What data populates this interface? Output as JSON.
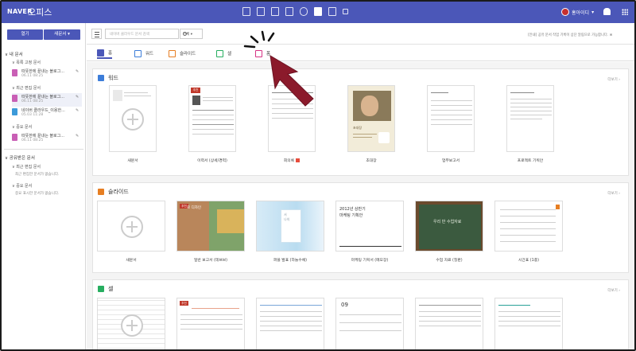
{
  "header": {
    "brand": "NAVER",
    "product": "오피스",
    "user": "홍아이디",
    "app_icons": [
      "mail-icon",
      "calendar-icon",
      "memo-icon",
      "contacts-icon",
      "cloud-icon",
      "office-icon",
      "home-icon",
      "more-icon"
    ]
  },
  "sidebar": {
    "open_label": "열기",
    "new_label": "새문서 ▾",
    "my_docs": "∨ 내 문서",
    "sub_recent_created": "∨ 목록 고정 문서",
    "created_docs": [
      {
        "name": "따뜻한에 끝내는 블로그...",
        "date": "06.11 08:25"
      }
    ],
    "sub_recent_edited": "∨ 최근 편집 문서",
    "edited_docs": [
      {
        "name": "따뜻한에 끝내는 블로그...",
        "date": "06.11 08:25"
      },
      {
        "name": "네이버 클라우드_이용한...",
        "date": "05.03 11:28"
      }
    ],
    "sub_important": "∨ 중요 문서",
    "important_docs": [
      {
        "name": "따뜻한에 끝내는 블로그...",
        "date": "06.11 08:25"
      }
    ],
    "shared": "∨ 공유받은 문서",
    "sub_shared_recent": "∨ 최근 편집 문서",
    "shared_recent_empty": "최근 편집한 문서가 없습니다.",
    "sub_shared_important": "∨ 중요 문서",
    "shared_important_empty": "중요 표시한 문서가 없습니다."
  },
  "toolbar": {
    "search_placeholder": "네이버 클라우드 문서 검색",
    "scope": "전체 ▾",
    "notice": "[안내] 공유 문서 작업 기록이 상단 알림으로 가능합니다. ⊗"
  },
  "tabs": [
    {
      "label": "홈",
      "color": "#4b57b8"
    },
    {
      "label": "워드",
      "color": "#3c7dd9"
    },
    {
      "label": "슬라이드",
      "color": "#e67e22"
    },
    {
      "label": "셀",
      "color": "#27ae60"
    },
    {
      "label": "폼",
      "color": "#d63384"
    }
  ],
  "sections": {
    "word": {
      "title": "워드",
      "more": "더보기 ›",
      "color": "#3c7dd9",
      "items": [
        "새문서",
        "이력서 (상세/경력)",
        "회의록",
        "초대장",
        "업무보고서",
        "프로젝트 기획안"
      ]
    },
    "slide": {
      "title": "슬라이드",
      "more": "더보기 ›",
      "color": "#e67e22",
      "items": [
        "새문서",
        "일반 보고서 (테브브)",
        "퍼블 발표 (하늘수채)",
        "마케팅 기획서 (메모장)",
        "수업 자료 (칠판)",
        "시간표 (1종)"
      ],
      "thumb_texts": {
        "t1_tag": "추천",
        "t1_title": "로 디자인",
        "t2_line1": "서",
        "t2_line2": "나의",
        "t3_title": "2012년 상반기",
        "t3_sub": "마케팅 기획안",
        "t4_title": "우리 반 수업자료"
      }
    },
    "cell": {
      "title": "셀",
      "more": "더보기 ›",
      "color": "#27ae60",
      "items": [
        "",
        "",
        "",
        "",
        "",
        ""
      ],
      "thumb_texts": {
        "c1_tag": "추천",
        "c3_num": "09"
      }
    }
  },
  "word_thumb_texts": {
    "w1_tag": "추천",
    "w3_title": "초대장"
  }
}
